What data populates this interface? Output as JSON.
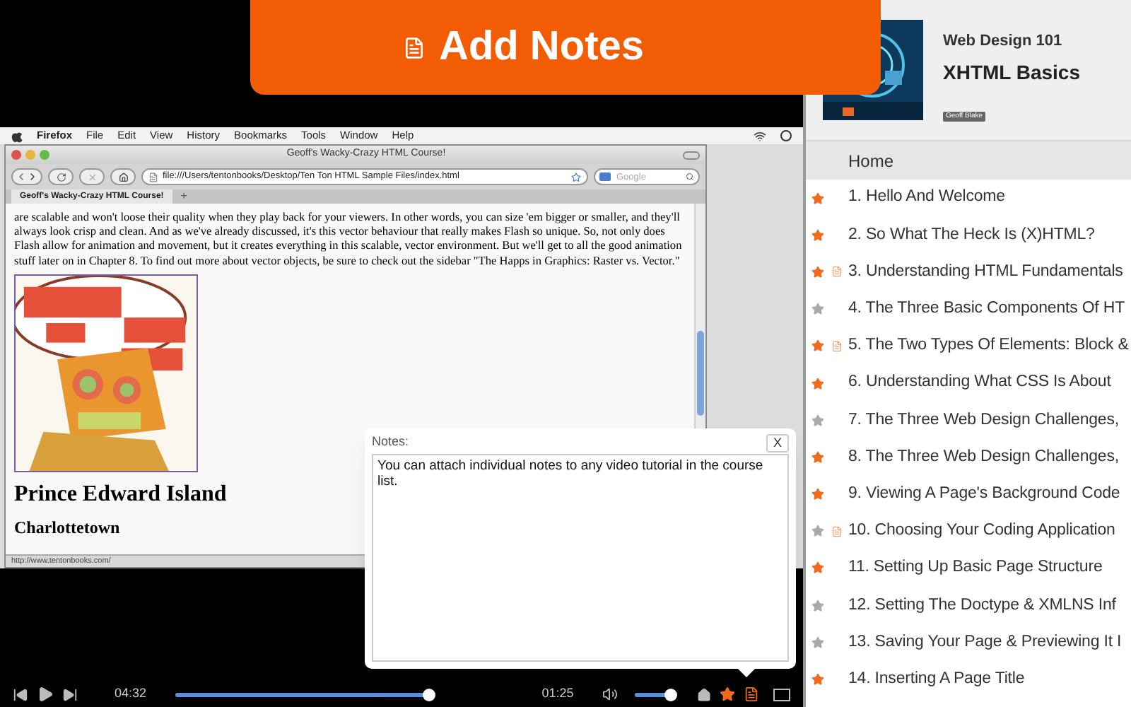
{
  "banner": {
    "title": "Add Notes"
  },
  "video": {
    "menu_bar": [
      {
        "label": "Firefox",
        "bold": true
      },
      {
        "label": "File",
        "bold": false
      },
      {
        "label": "Edit",
        "bold": false
      },
      {
        "label": "View",
        "bold": false
      },
      {
        "label": "History",
        "bold": false
      },
      {
        "label": "Bookmarks",
        "bold": false
      },
      {
        "label": "Tools",
        "bold": false
      },
      {
        "label": "Window",
        "bold": false
      },
      {
        "label": "Help",
        "bold": false
      }
    ],
    "browser": {
      "title": "Geoff's Wacky-Crazy HTML Course!",
      "url": "file:///Users/tentonbooks/Desktop/Ten Ton HTML Sample Files/index.html",
      "search": {
        "placeholder": "Google"
      },
      "tabs": [
        {
          "label": "Geoff's Wacky-Crazy HTML Course!",
          "selected": true
        }
      ],
      "new_tab": "+",
      "paragraph": "are scalable and won't loose their quality when they play back for your viewers. In other words, you can size 'em bigger or smaller, and they'll always look crisp and clean. And as we've already discussed, it's this vector behaviour that really makes Flash so unique. So, not only does Flash allow for animation and movement, but it creates everything in this scalable, vector environment. But we'll get to all the good animation stuff later on in Chapter 8. To find out more about vector objects, be sure to check out the sidebar \"The Happs in Graphics: Raster vs. Vector.\"",
      "heading": "Prince Edward Island",
      "subheading": "Charlottetown",
      "status": "http://www.tentonbooks.com/"
    }
  },
  "notes_popup": {
    "label": "Notes:",
    "close": "X",
    "value": "You can attach individual notes to any video tutorial in the course list."
  },
  "player": {
    "elapsed": "04:32",
    "progress": {
      "level": 0.98
    },
    "remaining": "01:25",
    "volume": {
      "level": 0.93
    },
    "starred": true,
    "notes_open": true
  },
  "course": {
    "series": "Web Design 101",
    "title": "XHTML Basics",
    "author": "Geoff Blake"
  },
  "home": {
    "label": "Home",
    "selected": true
  },
  "lessons": [
    {
      "title": "1. Hello And Welcome",
      "starred": true,
      "has_note": false
    },
    {
      "title": "2. So What The Heck Is (X)HTML?",
      "starred": true,
      "has_note": false
    },
    {
      "title": "3. Understanding HTML Fundamentals",
      "starred": true,
      "has_note": true
    },
    {
      "title": "4. The Three Basic Components Of HT",
      "starred": false,
      "has_note": false
    },
    {
      "title": "5. The Two Types Of Elements: Block &",
      "starred": true,
      "has_note": true
    },
    {
      "title": "6. Understanding What CSS Is About",
      "starred": true,
      "has_note": false
    },
    {
      "title": "7. The Three Web Design Challenges,",
      "starred": false,
      "has_note": false
    },
    {
      "title": "8. The Three Web Design Challenges,",
      "starred": true,
      "has_note": false
    },
    {
      "title": "9. Viewing A Page's Background Code",
      "starred": true,
      "has_note": false
    },
    {
      "title": "10. Choosing Your Coding Application",
      "starred": false,
      "has_note": true
    },
    {
      "title": "11. Setting Up Basic Page Structure",
      "starred": true,
      "has_note": false
    },
    {
      "title": "12. Setting The Doctype & XMLNS Inf",
      "starred": false,
      "has_note": false
    },
    {
      "title": "13. Saving Your Page & Previewing It I",
      "starred": false,
      "has_note": false
    },
    {
      "title": "14. Inserting A Page Title",
      "starred": true,
      "has_note": false
    }
  ]
}
